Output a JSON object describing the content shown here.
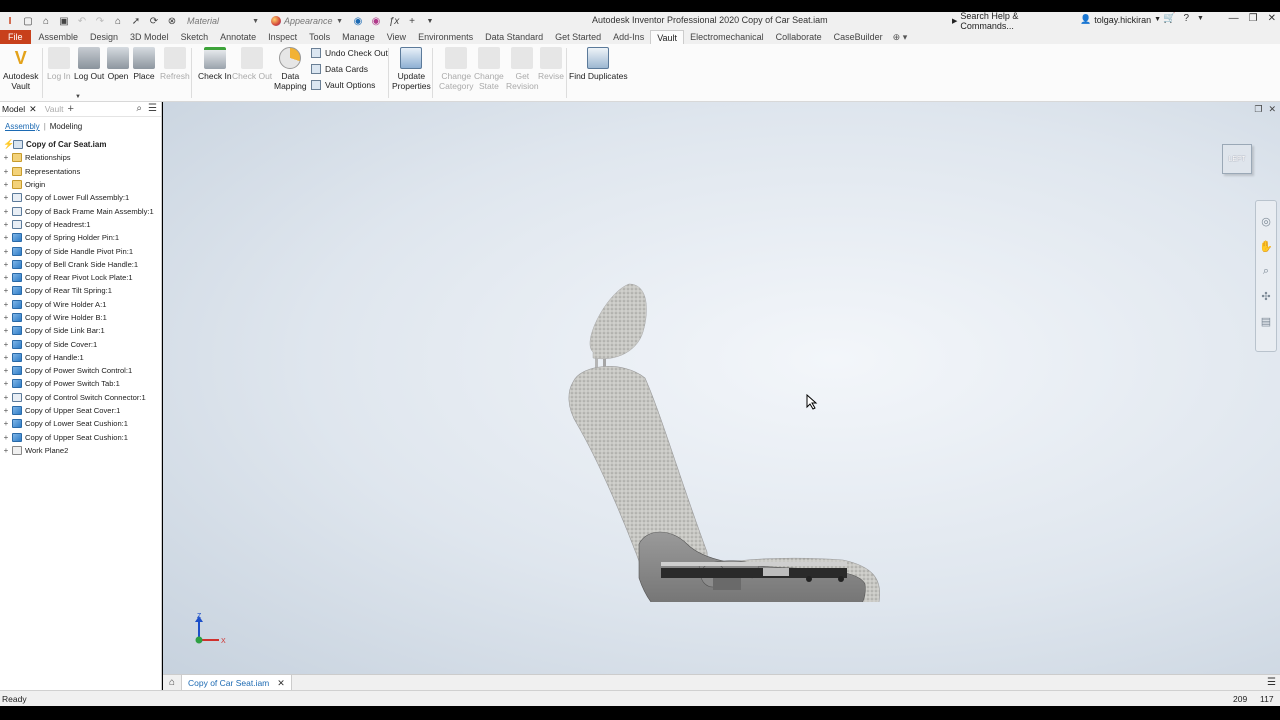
{
  "titlebar": {
    "app_title": "Autodesk Inventor Professional 2020    Copy of Car Seat.iam",
    "material": "Material",
    "appearance": "Appearance",
    "help_search": "Search Help & Commands...",
    "user": "tolgay.hickiran"
  },
  "ribbon_tabs": [
    "File",
    "Assemble",
    "Design",
    "3D Model",
    "Sketch",
    "Annotate",
    "Inspect",
    "Tools",
    "Manage",
    "View",
    "Environments",
    "Data Standard",
    "Get Started",
    "Add-Ins",
    "Vault",
    "Electromechanical",
    "Collaborate",
    "CaseBuilder"
  ],
  "active_tab": "Vault",
  "ribbon": {
    "autodesk_vault": [
      "Autodesk",
      "Vault"
    ],
    "log_in": "Log In",
    "log_out": "Log Out",
    "open": "Open",
    "place": "Place",
    "refresh": "Refresh",
    "check_in": "Check In",
    "check_out": "Check Out",
    "data_mapping": [
      "Data",
      "Mapping"
    ],
    "undo_check_out": "Undo Check Out",
    "data_cards": "Data Cards",
    "vault_options": "Vault Options",
    "update_properties": [
      "Update",
      "Properties"
    ],
    "change_category": [
      "Change",
      "Category"
    ],
    "change_state": [
      "Change",
      "State"
    ],
    "get_revision": [
      "Get",
      "Revision"
    ],
    "revise": "Revise",
    "find_duplicates": "Find Duplicates"
  },
  "browser": {
    "tab_model": "Model",
    "tab_vault": "Vault",
    "sub_assembly": "Assembly",
    "sub_modeling": "Modeling",
    "root": "Copy of Car Seat.iam",
    "items": [
      {
        "label": "Relationships",
        "icon": "folder"
      },
      {
        "label": "Representations",
        "icon": "folder"
      },
      {
        "label": "Origin",
        "icon": "folder"
      },
      {
        "label": "Copy of Lower Full Assembly:1",
        "icon": "asm"
      },
      {
        "label": "Copy of Back Frame Main Assembly:1",
        "icon": "asm"
      },
      {
        "label": "Copy of Headrest:1",
        "icon": "asm"
      },
      {
        "label": "Copy of Spring Holder Pin:1",
        "icon": "part"
      },
      {
        "label": "Copy of Side Handle Pivot Pin:1",
        "icon": "part"
      },
      {
        "label": "Copy of Bell Crank Side Handle:1",
        "icon": "part"
      },
      {
        "label": "Copy of Rear Pivot Lock Plate:1",
        "icon": "part"
      },
      {
        "label": "Copy of Rear Tilt Spring:1",
        "icon": "part"
      },
      {
        "label": "Copy of Wire Holder A:1",
        "icon": "part"
      },
      {
        "label": "Copy of Wire Holder B:1",
        "icon": "part"
      },
      {
        "label": "Copy of Side Link Bar:1",
        "icon": "part"
      },
      {
        "label": "Copy of Side Cover:1",
        "icon": "part"
      },
      {
        "label": "Copy of Handle:1",
        "icon": "part"
      },
      {
        "label": "Copy of Power Switch Control:1",
        "icon": "part"
      },
      {
        "label": "Copy of Power Switch Tab:1",
        "icon": "part"
      },
      {
        "label": "Copy of Control Switch Connector:1",
        "icon": "asm"
      },
      {
        "label": "Copy of Upper Seat Cover:1",
        "icon": "part"
      },
      {
        "label": "Copy of Lower Seat Cushion:1",
        "icon": "part"
      },
      {
        "label": "Copy of Upper Seat Cushion:1",
        "icon": "part"
      },
      {
        "label": "Work Plane2",
        "icon": "plane"
      }
    ]
  },
  "viewport": {
    "viewcube_face": "LEFT",
    "triad_z": "Z",
    "triad_x": "X"
  },
  "doc_tab": "Copy of Car Seat.iam",
  "status": {
    "text": "Ready",
    "num1": "209",
    "num2": "117"
  },
  "colors": {
    "file_tab": "#c8401b",
    "accent_blue": "#1c6ab3"
  }
}
